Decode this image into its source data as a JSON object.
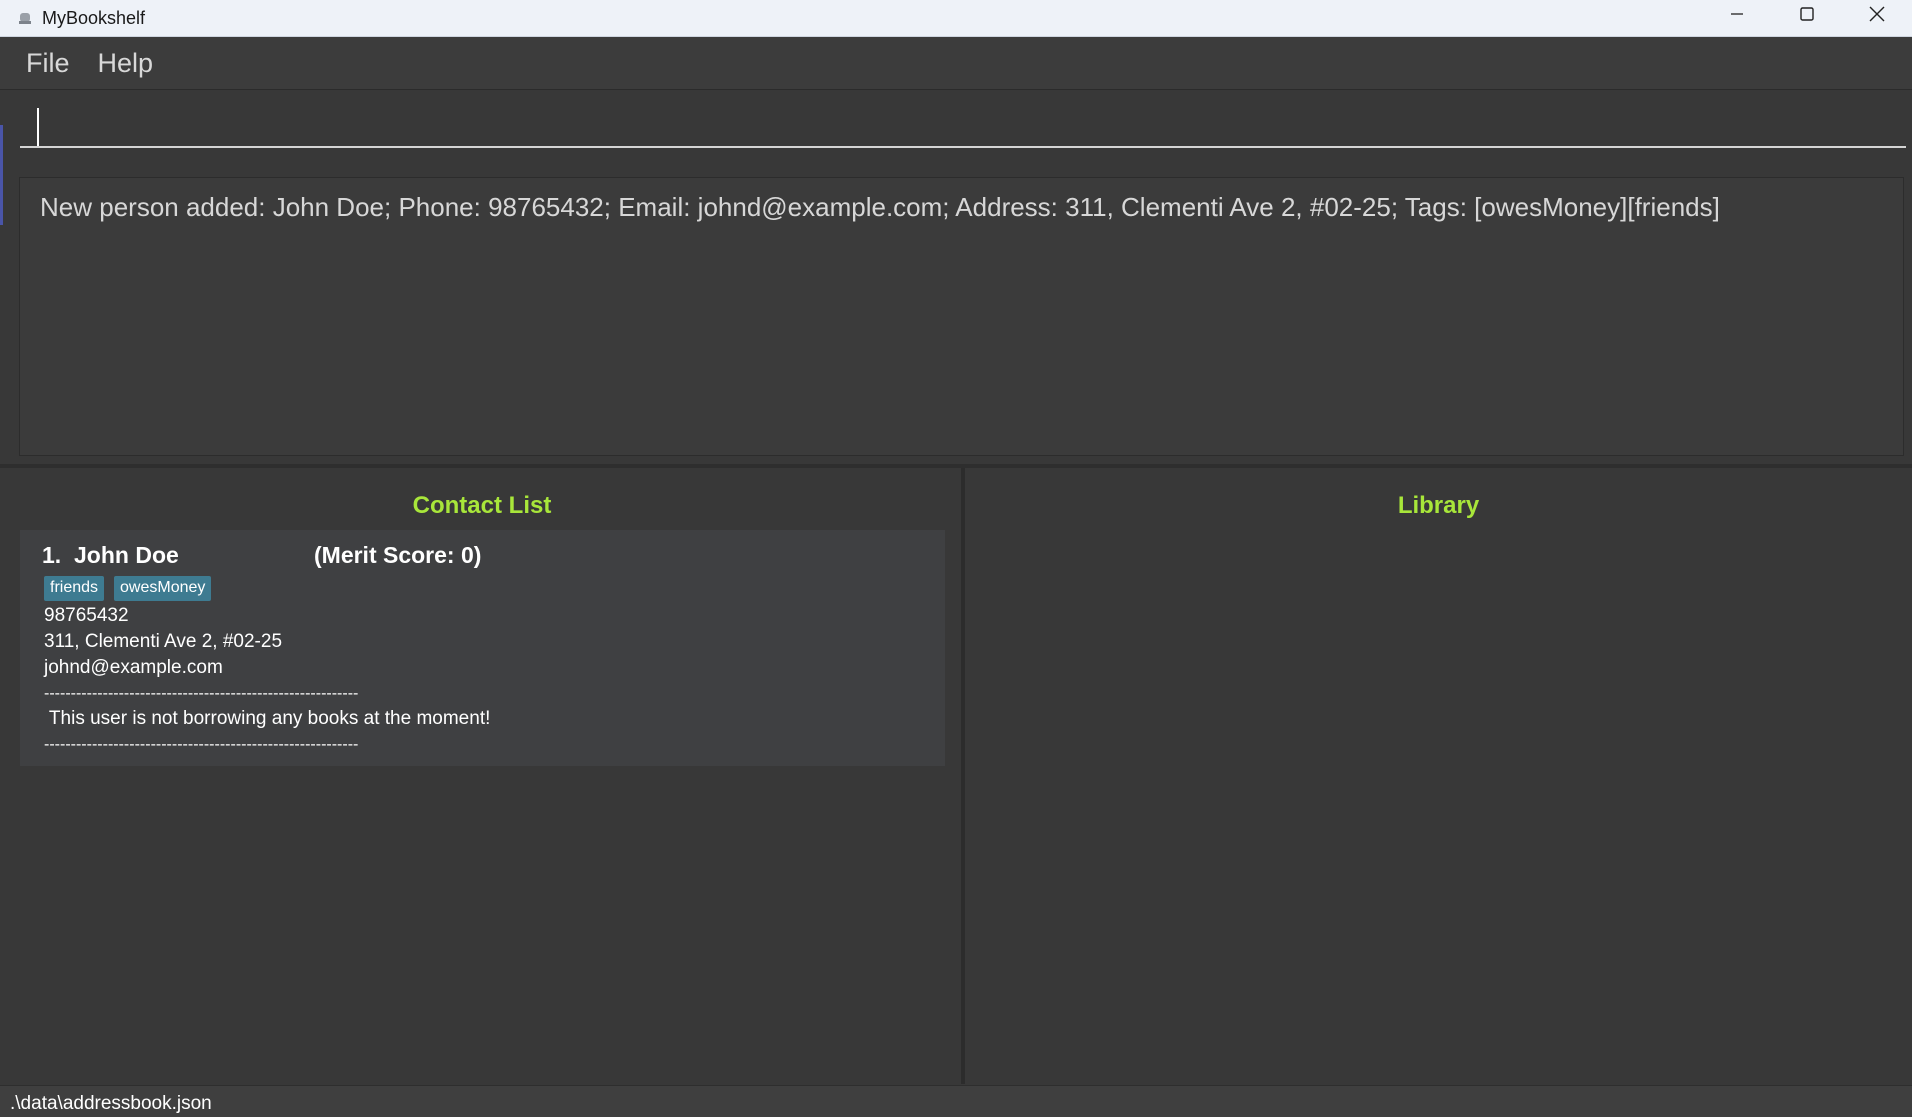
{
  "window": {
    "title": "MyBookshelf",
    "controls": {
      "minimize": "minimize",
      "maximize": "maximize",
      "close": "close"
    }
  },
  "menu": {
    "items": [
      {
        "label": "File"
      },
      {
        "label": "Help"
      }
    ]
  },
  "command": {
    "value": "",
    "placeholder": ""
  },
  "result": {
    "text": "New person added: John Doe; Phone: 98765432; Email: johnd@example.com; Address: 311, Clementi Ave 2, #02-25; Tags: [owesMoney][friends]"
  },
  "contact_list": {
    "title": "Contact List",
    "persons": [
      {
        "index": "1.",
        "name": "John Doe",
        "merit": "(Merit Score: 0)",
        "tags": [
          "friends",
          "owesMoney"
        ],
        "phone": "98765432",
        "address": "311, Clementi Ave 2, #02-25",
        "email": "johnd@example.com",
        "separator": "-----------------------------------------------------------",
        "borrow_status": " This user is not borrowing any books at the moment!"
      }
    ]
  },
  "library": {
    "title": "Library"
  },
  "status_bar": {
    "path": ".\\data\\addressbook.json"
  },
  "colors": {
    "background": "#383838",
    "panel_title": "#a8e63a",
    "tag": "#3e7b91",
    "card": "#3f4042"
  }
}
